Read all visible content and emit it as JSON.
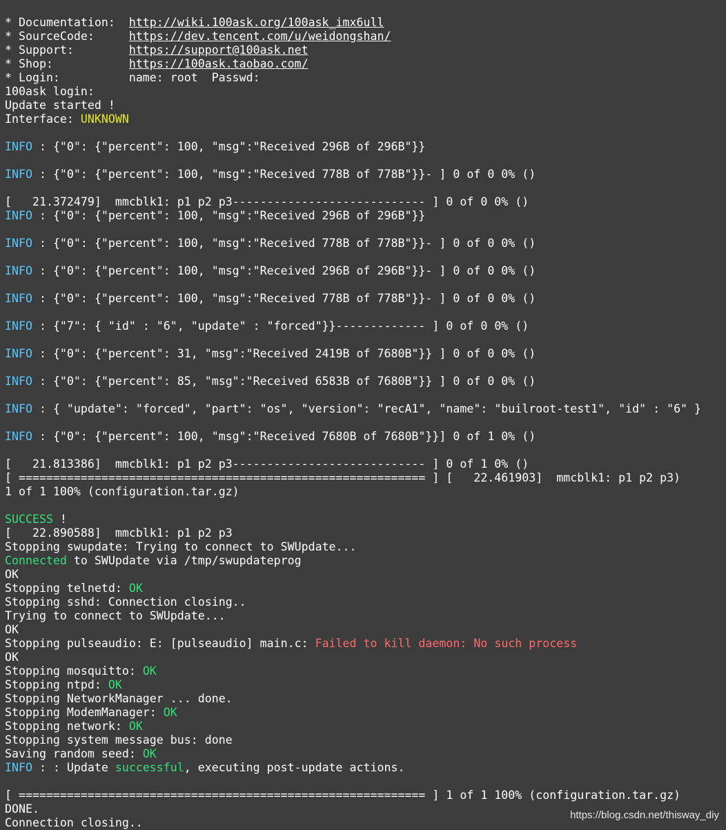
{
  "colors": {
    "background": "#3c3c3c",
    "text": "#ffffff",
    "info": "#58c8ff",
    "warning": "#e6e62a",
    "ok": "#33e07a",
    "error": "#ff6b6b"
  },
  "lines": [
    [
      {
        "t": "* Documentation:  ",
        "c": "white"
      },
      {
        "t": "http://wiki.100ask.org/100ask_imx6ull",
        "c": "link"
      }
    ],
    [
      {
        "t": "* SourceCode:     ",
        "c": "white"
      },
      {
        "t": "https://dev.tencent.com/u/weidongshan/",
        "c": "link"
      }
    ],
    [
      {
        "t": "* Support:        ",
        "c": "white"
      },
      {
        "t": "https://support@100ask.net",
        "c": "link"
      }
    ],
    [
      {
        "t": "* Shop:           ",
        "c": "white"
      },
      {
        "t": "https://100ask.taobao.com/",
        "c": "link"
      }
    ],
    [
      {
        "t": "* Login:          name: root  Passwd:",
        "c": "white"
      }
    ],
    [
      {
        "t": "100ask login:",
        "c": "white"
      }
    ],
    [
      {
        "t": "Update started !",
        "c": "white"
      }
    ],
    [
      {
        "t": "Interface: ",
        "c": "white"
      },
      {
        "t": "UNKNOWN",
        "c": "yellow"
      }
    ],
    [],
    [
      {
        "t": "INFO",
        "c": "cyan"
      },
      {
        "t": " : {\"0\": {\"percent\": 100, \"msg\":\"Received 296B of 296B\"}}",
        "c": "white"
      }
    ],
    [],
    [
      {
        "t": "INFO",
        "c": "cyan"
      },
      {
        "t": " : {\"0\": {\"percent\": 100, \"msg\":\"Received 778B of 778B\"}}- ] 0 of 0 0% ()",
        "c": "white"
      }
    ],
    [],
    [
      {
        "t": "[   21.372479]  mmcblk1: p1 p2 p3---------------------------- ] 0 of 0 0% ()",
        "c": "white"
      }
    ],
    [
      {
        "t": "INFO",
        "c": "cyan"
      },
      {
        "t": " : {\"0\": {\"percent\": 100, \"msg\":\"Received 296B of 296B\"}}",
        "c": "white"
      }
    ],
    [],
    [
      {
        "t": "INFO",
        "c": "cyan"
      },
      {
        "t": " : {\"0\": {\"percent\": 100, \"msg\":\"Received 778B of 778B\"}}- ] 0 of 0 0% ()",
        "c": "white"
      }
    ],
    [],
    [
      {
        "t": "INFO",
        "c": "cyan"
      },
      {
        "t": " : {\"0\": {\"percent\": 100, \"msg\":\"Received 296B of 296B\"}}- ] 0 of 0 0% ()",
        "c": "white"
      }
    ],
    [],
    [
      {
        "t": "INFO",
        "c": "cyan"
      },
      {
        "t": " : {\"0\": {\"percent\": 100, \"msg\":\"Received 778B of 778B\"}}- ] 0 of 0 0% ()",
        "c": "white"
      }
    ],
    [],
    [
      {
        "t": "INFO",
        "c": "cyan"
      },
      {
        "t": " : {\"7\": { \"id\" : \"6\", \"update\" : \"forced\"}}------------- ] 0 of 0 0% ()",
        "c": "white"
      }
    ],
    [],
    [
      {
        "t": "INFO",
        "c": "cyan"
      },
      {
        "t": " : {\"0\": {\"percent\": 31, \"msg\":\"Received 2419B of 7680B\"}} ] 0 of 0 0% ()",
        "c": "white"
      }
    ],
    [],
    [
      {
        "t": "INFO",
        "c": "cyan"
      },
      {
        "t": " : {\"0\": {\"percent\": 85, \"msg\":\"Received 6583B of 7680B\"}} ] 0 of 0 0% ()",
        "c": "white"
      }
    ],
    [],
    [
      {
        "t": "INFO",
        "c": "cyan"
      },
      {
        "t": " : { \"update\": \"forced\", \"part\": \"os\", \"version\": \"recA1\", \"name\": \"builroot-test1\", \"id\" : \"6\" }",
        "c": "white"
      }
    ],
    [],
    [
      {
        "t": "INFO",
        "c": "cyan"
      },
      {
        "t": " : {\"0\": {\"percent\": 100, \"msg\":\"Received 7680B of 7680B\"}}] 0 of 1 0% ()",
        "c": "white"
      }
    ],
    [],
    [
      {
        "t": "[   21.813386]  mmcblk1: p1 p2 p3---------------------------- ] 0 of 1 0% ()",
        "c": "white"
      }
    ],
    [
      {
        "t": "[ =========================================================== ] [   22.461903]  mmcblk1: p1 p2 p3)",
        "c": "white"
      }
    ],
    [
      {
        "t": "1 of 1 100% (configuration.tar.gz)",
        "c": "white"
      }
    ],
    [],
    [
      {
        "t": "SUCCESS",
        "c": "green"
      },
      {
        "t": " !",
        "c": "white"
      }
    ],
    [
      {
        "t": "[   22.890588]  mmcblk1: p1 p2 p3",
        "c": "white"
      }
    ],
    [
      {
        "t": "Stopping swupdate: Trying to connect to SWUpdate...",
        "c": "white"
      }
    ],
    [
      {
        "t": "Connected",
        "c": "green"
      },
      {
        "t": " to SWUpdate via /tmp/swupdateprog",
        "c": "white"
      }
    ],
    [
      {
        "t": "OK",
        "c": "white"
      }
    ],
    [
      {
        "t": "Stopping telnetd: ",
        "c": "white"
      },
      {
        "t": "OK",
        "c": "green"
      }
    ],
    [
      {
        "t": "Stopping sshd: Connection closing..",
        "c": "white"
      }
    ],
    [
      {
        "t": "Trying to connect to SWUpdate...",
        "c": "white"
      }
    ],
    [
      {
        "t": "OK",
        "c": "white"
      }
    ],
    [
      {
        "t": "Stopping pulseaudio: E: [pulseaudio] main.c: ",
        "c": "white"
      },
      {
        "t": "Failed to kill daemon: No such process",
        "c": "red"
      }
    ],
    [
      {
        "t": "OK",
        "c": "white"
      }
    ],
    [
      {
        "t": "Stopping mosquitto: ",
        "c": "white"
      },
      {
        "t": "OK",
        "c": "green"
      }
    ],
    [
      {
        "t": "Stopping ntpd: ",
        "c": "white"
      },
      {
        "t": "OK",
        "c": "green"
      }
    ],
    [
      {
        "t": "Stopping NetworkManager ... done.",
        "c": "white"
      }
    ],
    [
      {
        "t": "Stopping ModemManager: ",
        "c": "white"
      },
      {
        "t": "OK",
        "c": "green"
      }
    ],
    [
      {
        "t": "Stopping network: ",
        "c": "white"
      },
      {
        "t": "OK",
        "c": "green"
      }
    ],
    [
      {
        "t": "Stopping system message bus: done",
        "c": "white"
      }
    ],
    [
      {
        "t": "Saving random seed: ",
        "c": "white"
      },
      {
        "t": "OK",
        "c": "green"
      }
    ],
    [
      {
        "t": "INFO",
        "c": "cyan"
      },
      {
        "t": " : : Update ",
        "c": "white"
      },
      {
        "t": "successful",
        "c": "green"
      },
      {
        "t": ", executing post-update actions.",
        "c": "white"
      }
    ],
    [],
    [
      {
        "t": "[ =========================================================== ] 1 of 1 100% (configuration.tar.gz)",
        "c": "white"
      }
    ],
    [
      {
        "t": "DONE.",
        "c": "white"
      }
    ],
    [
      {
        "t": "Connection closing..",
        "c": "white"
      }
    ]
  ],
  "watermark": "https://blog.csdn.net/thisway_diy"
}
